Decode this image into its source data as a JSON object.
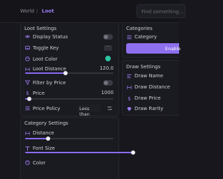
{
  "breadcrumb": {
    "world": "World",
    "separator": "/",
    "loot": "Loot"
  },
  "search": {
    "placeholder": "Find something..."
  },
  "loot_settings": {
    "title": "Loot Settings",
    "display_status": {
      "label": "Display Status",
      "icon": "eye-icon",
      "on": false
    },
    "toggle_key": {
      "label": "Toggle Key",
      "icon": "keyboard-icon",
      "button": "···"
    },
    "loot_color": {
      "label": "Loot Color",
      "icon": "palette-icon",
      "color": "#2ec4a2"
    },
    "loot_distance": {
      "label": "Loot Distance",
      "icon": "distance-icon",
      "value": "120.0",
      "fraction": 0.46
    },
    "filter_by_price": {
      "label": "Filter by Price",
      "icon": "filter-icon",
      "on": false
    },
    "price": {
      "label": "Price",
      "icon": "dollar-icon",
      "value": "1000",
      "fraction": 0.05
    },
    "price_policy": {
      "label": "Price Policy",
      "icon": "list-icon",
      "selected": "Less than"
    }
  },
  "category_settings": {
    "title": "Category Settings",
    "distance": {
      "label": "Distance",
      "icon": "distance-icon",
      "fraction": 0.26
    },
    "font_size": {
      "label": "Font Size",
      "icon": "font-size-icon",
      "fraction": 1.0
    },
    "color": {
      "label": "Color",
      "icon": "palette-icon"
    }
  },
  "categories": {
    "title": "Categories",
    "category": {
      "label": "Category",
      "icon": "list-icon"
    },
    "enable_button": "Enable"
  },
  "draw_settings": {
    "title": "Draw Settings",
    "items": [
      {
        "label": "Draw Name",
        "icon": "name-icon"
      },
      {
        "label": "Draw Distance",
        "icon": "distance-icon"
      },
      {
        "label": "Draw Price",
        "icon": "dollar-icon"
      },
      {
        "label": "Draw Rarity",
        "icon": "gem-icon"
      }
    ]
  },
  "colors": {
    "accent": "#8c6cf2",
    "loot_color": "#2ec4a2",
    "background": "#17171d"
  }
}
